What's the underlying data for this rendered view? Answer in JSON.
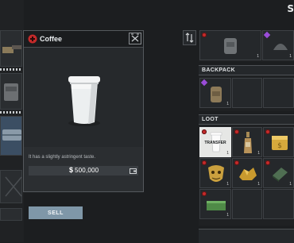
{
  "popup": {
    "title": "Coffee",
    "description": "It has a slightly astringent taste.",
    "price": "500,000",
    "currency_symbol": "$",
    "sell_label": "SELL",
    "item_icon": "coffee-cup",
    "close_icon": "close-x"
  },
  "sections": {
    "backpack": "BACKPACK",
    "loot": "LOOT",
    "bottom_partial": ""
  },
  "loot": {
    "transfer_label": "TRANSFER",
    "items": [
      {
        "name": "coffee",
        "qty": "1",
        "badge": "red",
        "selected": true
      },
      {
        "name": "bottle",
        "qty": "1",
        "badge": "red"
      },
      {
        "name": "gold-box",
        "qty": "1",
        "badge": "red"
      },
      {
        "name": "gold-mask",
        "qty": "1",
        "badge": "red"
      },
      {
        "name": "gold-ore",
        "qty": "1",
        "badge": "red"
      },
      {
        "name": "green-book",
        "qty": "1",
        "badge": "red"
      },
      {
        "name": "green-chest",
        "qty": "1",
        "badge": "red"
      }
    ]
  },
  "backpack": {
    "qty": "1"
  },
  "equip": {
    "qty1": "1",
    "qty2": "1"
  },
  "corner": "S"
}
